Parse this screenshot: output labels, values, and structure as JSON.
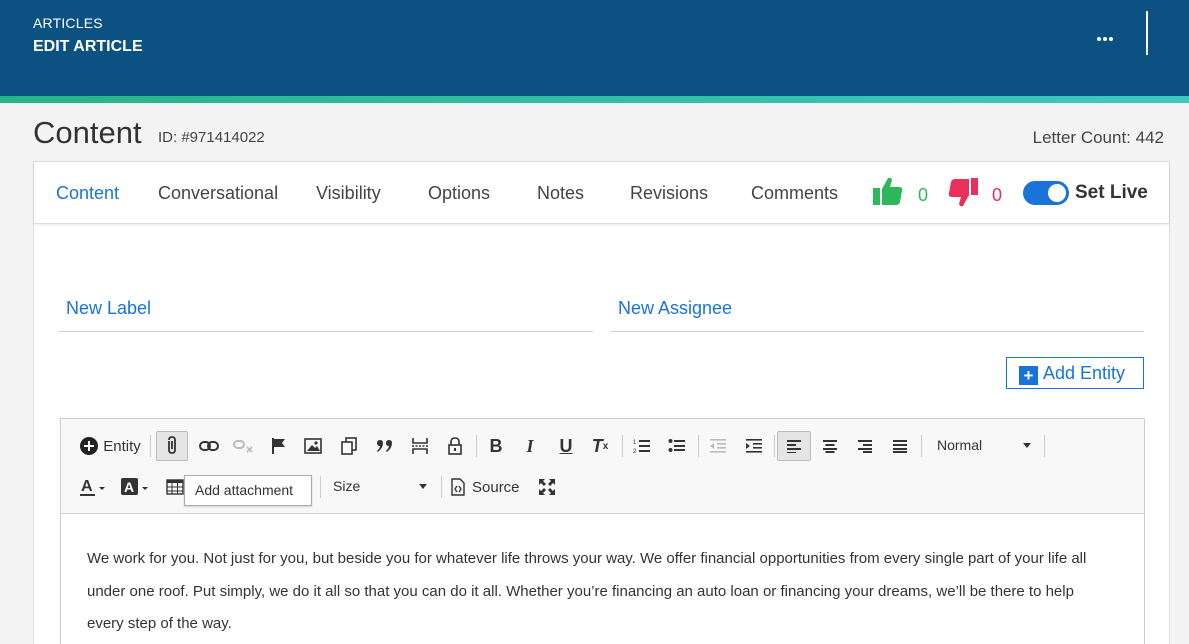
{
  "header": {
    "breadcrumb": "ARTICLES",
    "title": "EDIT ARTICLE"
  },
  "page": {
    "title": "Content",
    "id_label": "ID: #971414022",
    "letter_count": "Letter Count: 442"
  },
  "tabs": [
    {
      "label": "Content",
      "active": true
    },
    {
      "label": "Conversational"
    },
    {
      "label": "Visibility"
    },
    {
      "label": "Options"
    },
    {
      "label": "Notes"
    },
    {
      "label": "Revisions"
    },
    {
      "label": "Comments"
    }
  ],
  "votes": {
    "up": "0",
    "down": "0",
    "up_color": "#2eb85c",
    "down_color": "#e8305a"
  },
  "set_live": {
    "label": "Set Live",
    "on": true
  },
  "fields": {
    "label": "New Label",
    "assignee": "New Assignee"
  },
  "add_entity": {
    "label": "Add Entity"
  },
  "toolbar": {
    "entity_label": "Entity",
    "format_select": "Normal",
    "size_select": "Size",
    "source_label": "Source",
    "tooltip": "Add attachment"
  },
  "editor": {
    "content": "We work for you. Not just for you, but beside you for whatever life throws your way. We offer financial opportunities from every single part of your life all under one roof. Put simply, we do it all so that you can do it all. Whether you’re financing an auto loan or financing your dreams, we’ll be there to help every step of the way."
  },
  "colors": {
    "header_bg": "#0b5282",
    "accent": "#1a73d9"
  }
}
